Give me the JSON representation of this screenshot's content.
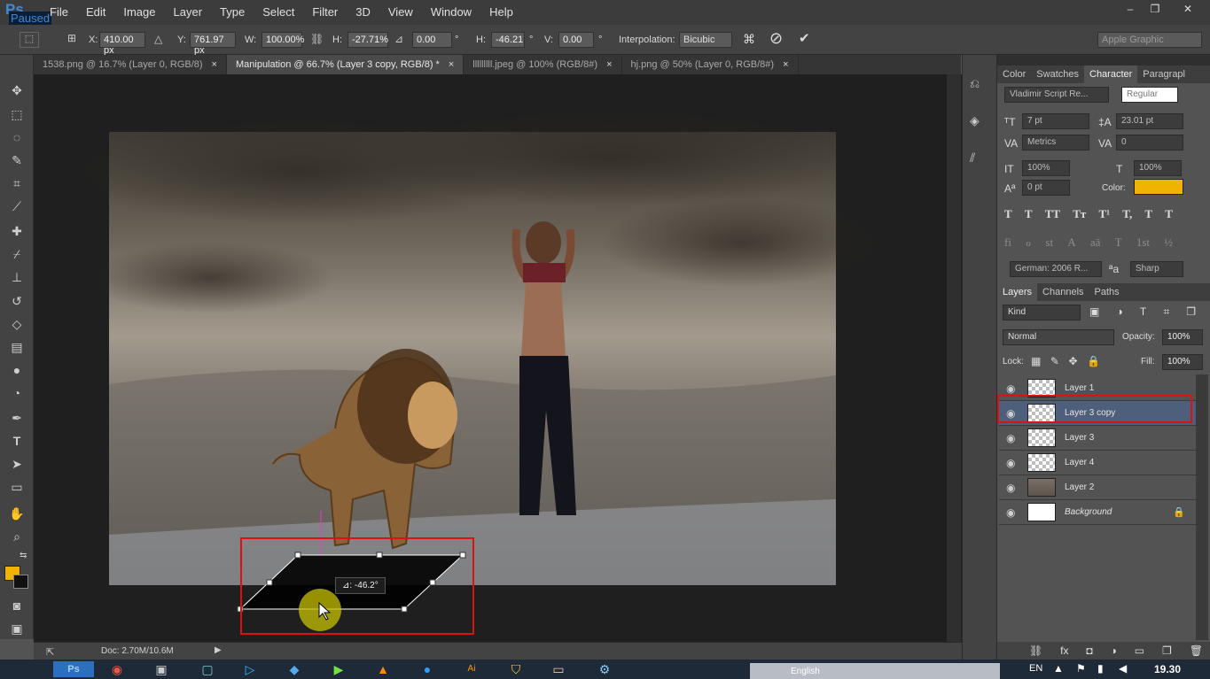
{
  "app": {
    "logo": "Ps",
    "paused_label": "Paused"
  },
  "menu": [
    "File",
    "Edit",
    "Image",
    "Layer",
    "Type",
    "Select",
    "Filter",
    "3D",
    "View",
    "Window",
    "Help"
  ],
  "window_controls": {
    "minimize": "–",
    "restore": "❐",
    "close": "✕"
  },
  "options": {
    "x_label": "X:",
    "x_value": "410.00 px",
    "y_label": "Y:",
    "y_value": "761.97 px",
    "w_label": "W:",
    "w_value": "100.00%",
    "h_label": "H:",
    "h_value": "-27.71%",
    "angle_value": "0.00",
    "angle_unit": "°",
    "hskew_label": "H:",
    "hskew_value": "-46.21",
    "hskew_unit": "°",
    "vskew_label": "V:",
    "vskew_value": "0.00",
    "vskew_unit": "°",
    "interp_label": "Interpolation:",
    "interp_value": "Bicubic",
    "workspace": "Apple Graphic",
    "cancel_glyph": "⊘",
    "commit_glyph": "✔"
  },
  "tabs": [
    {
      "label": "1538.png @ 16.7% (Layer 0, RGB/8)",
      "close": "×",
      "active": false
    },
    {
      "label": "Manipulation @ 66.7% (Layer 3 copy, RGB/8) *",
      "close": "×",
      "active": true
    },
    {
      "label": "lllllllll.jpeg @ 100% (RGB/8#)",
      "close": "×",
      "active": false
    },
    {
      "label": "hj.png @ 50% (Layer 0, RGB/8#)",
      "close": "×",
      "active": false
    }
  ],
  "transform_tooltip": "⊿: -46.2°",
  "status": {
    "doc": "Doc: 2.70M/10.6M"
  },
  "character_panel": {
    "tabs": [
      "Color",
      "Swatches",
      "Character",
      "Paragrapl"
    ],
    "font_family": "Vladimir Script Re...",
    "font_style": "Regular",
    "font_size": "7 pt",
    "leading": "23.01 pt",
    "kerning": "Metrics",
    "tracking": "0",
    "vscale": "100%",
    "hscale": "100%",
    "baseline": "0 pt",
    "color_label": "Color:",
    "text_color": "#f0b400",
    "style_glyphs": [
      "T",
      "T",
      "TT",
      "Tт",
      "T¹",
      "T,",
      "T",
      "T"
    ],
    "opentype_glyphs": [
      "fi",
      "ℴ",
      "st",
      "A",
      "aā",
      "T",
      "1st",
      "½"
    ],
    "language": "German: 2006 R...",
    "aa_label": "ªa",
    "antialias": "Sharp"
  },
  "layers_panel": {
    "tabs": [
      "Layers",
      "Channels",
      "Paths"
    ],
    "filter": "Kind",
    "blend_mode": "Normal",
    "opacity_label": "Opacity:",
    "opacity": "100%",
    "lock_label": "Lock:",
    "fill_label": "Fill:",
    "fill": "100%",
    "layers": [
      {
        "name": "Layer 1",
        "selected": false
      },
      {
        "name": "Layer 3 copy",
        "selected": true
      },
      {
        "name": "Layer 3",
        "selected": false
      },
      {
        "name": "Layer 4",
        "selected": false
      },
      {
        "name": "Layer 2",
        "selected": false
      },
      {
        "name": "Background",
        "selected": false
      }
    ],
    "footer_glyphs": [
      "⛓",
      "fx",
      "◘",
      "◑",
      "▭",
      "❐",
      "🗑"
    ]
  },
  "taskbar": {
    "language_bar": "English",
    "input_lang": "EN",
    "clock": "19.30"
  },
  "colors": {
    "foreground": "#f0b400",
    "background": "#111111",
    "highlight_red": "#e01010"
  }
}
